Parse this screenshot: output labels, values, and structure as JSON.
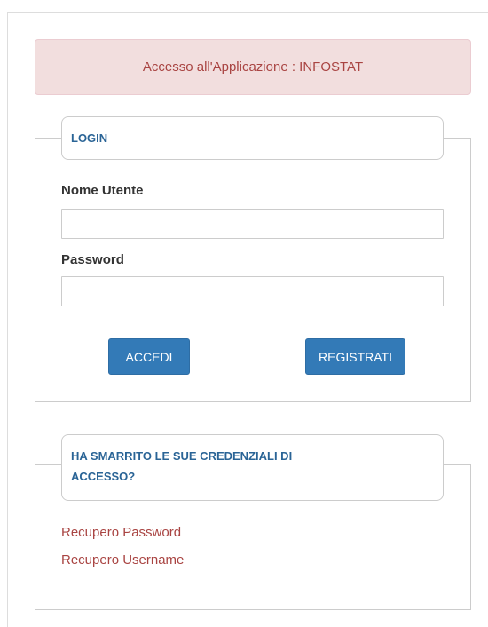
{
  "alert": {
    "text": "Accesso all'Applicazione : INFOSTAT"
  },
  "login": {
    "legend": "LOGIN",
    "username_label": "Nome Utente",
    "username_value": "",
    "password_label": "Password",
    "password_value": "",
    "login_button": "ACCEDI",
    "register_button": "REGISTRATI"
  },
  "recover": {
    "legend_line1": "HA SMARRITO LE SUE CREDENZIALI DI",
    "legend_line2": "ACCESSO?",
    "recover_password_link": "Recupero Password",
    "recover_username_link": "Recupero Username"
  },
  "colors": {
    "alert_bg": "#f2dede",
    "alert_text": "#a94442",
    "legend_text": "#2a6496",
    "button_bg": "#337ab7",
    "link": "#a94442"
  }
}
